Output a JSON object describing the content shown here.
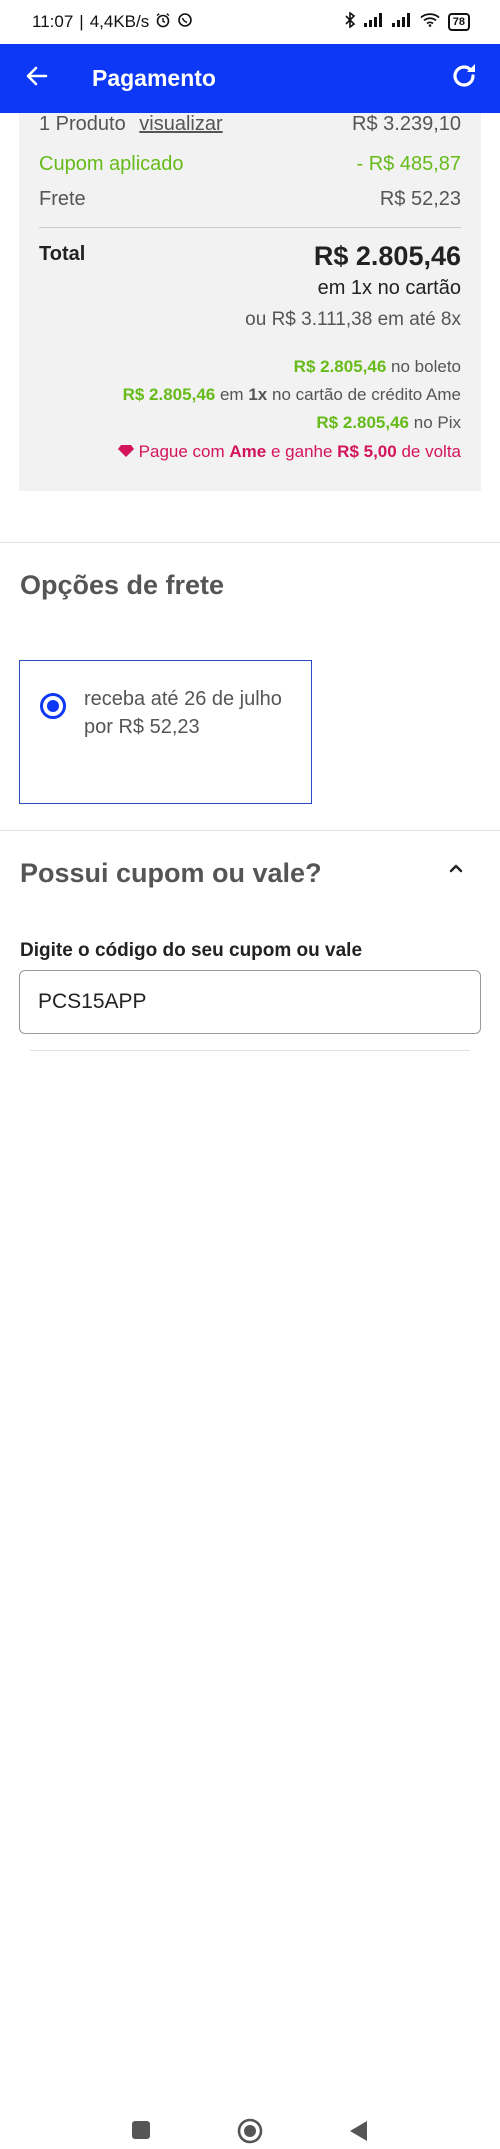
{
  "status_bar": {
    "time": "11:07",
    "network_speed": "4,4KB/s",
    "battery": "78",
    "icons": [
      "alarm-icon",
      "whatsapp-icon",
      "bluetooth-icon",
      "signal-icon",
      "signal-icon",
      "wifi-icon",
      "battery-icon"
    ]
  },
  "app_bar": {
    "title": "Pagamento",
    "background": "#0d38f5"
  },
  "summary": {
    "products_label": "1 Produto",
    "view_link": "visualizar",
    "products_value": "R$ 3.239,10",
    "coupon_label": "Cupom aplicado",
    "coupon_value": "- R$ 485,87",
    "shipping_label": "Frete",
    "shipping_value": "R$ 52,23",
    "total_label": "Total",
    "total_value": "R$ 2.805,46",
    "total_sub1": "em 1x no cartão",
    "total_sub2": "ou R$ 3.111,38 em até 8x",
    "promo_boleto_value": "R$ 2.805,46",
    "promo_boleto_text": "no boleto",
    "promo_ame_value": "R$ 2.805,46",
    "promo_ame_mid": "em",
    "promo_ame_times": "1x",
    "promo_ame_text": "no cartão de crédito Ame",
    "promo_pix_value": "R$ 2.805,46",
    "promo_pix_text": "no Pix",
    "cashback_prefix": "Pague com",
    "cashback_brand": "Ame",
    "cashback_mid": "e ganhe",
    "cashback_value": "R$ 5,00",
    "cashback_suffix": "de volta",
    "green": "#66bb1a",
    "pink": "#d4145a"
  },
  "shipping_options": {
    "title": "Opções de frete",
    "option_text": "receba até 26 de julho por R$ 52,23"
  },
  "coupon": {
    "title": "Possui cupom ou vale?",
    "field_label": "Digite o código do seu cupom ou vale",
    "field_value": "PCS15APP"
  }
}
